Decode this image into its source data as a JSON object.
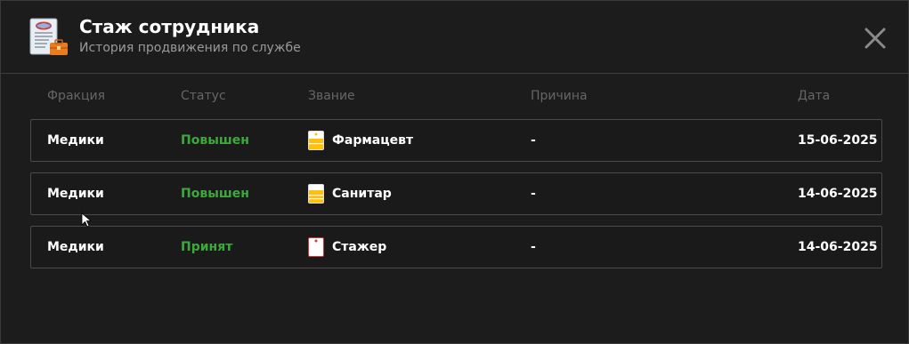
{
  "header": {
    "title": "Стаж сотрудника",
    "subtitle": "История продвижения по службе",
    "icon": "document-briefcase-icon",
    "close_icon": "close-icon"
  },
  "columns": [
    "Фракция",
    "Статус",
    "Звание",
    "Причина",
    "Дата"
  ],
  "rows": [
    {
      "faction": "Медики",
      "status": "Повышен",
      "rank": "Фармацевт",
      "rank_icon": "rank-badge-icon",
      "reason": "-",
      "date": "15-06-2025"
    },
    {
      "faction": "Медики",
      "status": "Повышен",
      "rank": "Санитар",
      "rank_icon": "rank-badge-icon",
      "reason": "-",
      "date": "14-06-2025"
    },
    {
      "faction": "Медики",
      "status": "Принят",
      "rank": "Стажер",
      "rank_icon": "rank-badge-empty-icon",
      "reason": "-",
      "date": "14-06-2025"
    }
  ],
  "colors": {
    "background": "#1c1c1c",
    "status_green": "#3da93d",
    "badge_gold": "#ffc107"
  }
}
